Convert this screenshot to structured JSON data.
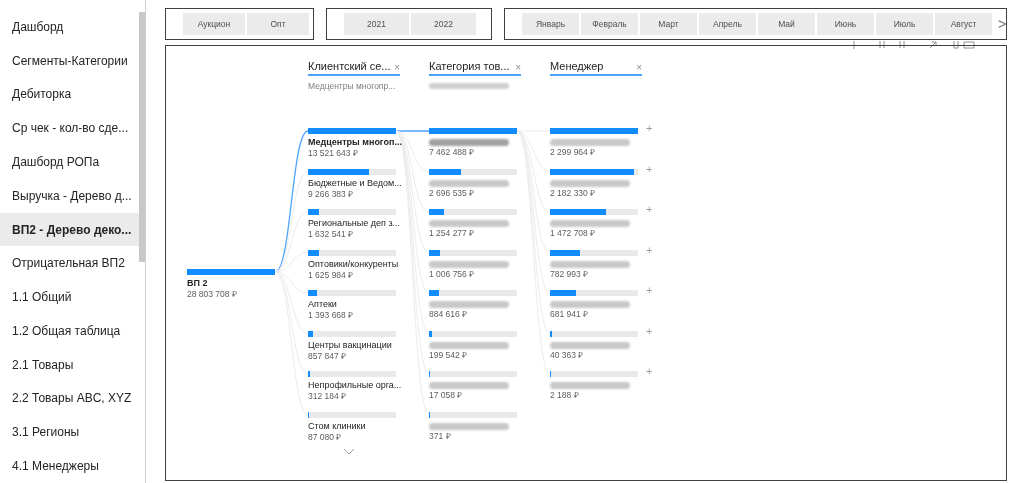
{
  "sidebar": {
    "items": [
      {
        "label": "Дашборд",
        "selected": false
      },
      {
        "label": "Сегменты-Категории",
        "selected": false
      },
      {
        "label": "Дебиторка",
        "selected": false
      },
      {
        "label": "Ср чек - кол-во сде...",
        "selected": false
      },
      {
        "label": "Дашборд РОПа",
        "selected": false
      },
      {
        "label": "Выручка - Дерево д...",
        "selected": false
      },
      {
        "label": "ВП2 - Дерево деко...",
        "selected": true
      },
      {
        "label": "Отрицательная ВП2",
        "selected": false
      },
      {
        "label": "1.1 Общий",
        "selected": false
      },
      {
        "label": "1.2 Общая таблица",
        "selected": false
      },
      {
        "label": "2.1 Товары",
        "selected": false
      },
      {
        "label": "2.2 Товары ABC, XYZ",
        "selected": false
      },
      {
        "label": "3.1 Регионы",
        "selected": false
      },
      {
        "label": "4.1 Менеджеры",
        "selected": false
      }
    ]
  },
  "slicers": [
    {
      "buttons": [
        "Аукцион",
        "Опт"
      ]
    },
    {
      "buttons": [
        "2021",
        "2022"
      ]
    },
    {
      "buttons": [
        "Январь",
        "Февраль",
        "Март",
        "Апрель",
        "Май",
        "Июнь",
        "Июль",
        "Август"
      ],
      "next": ">"
    }
  ],
  "tree": {
    "root": {
      "kind": "text",
      "label": "ВП 2",
      "value": "28 803 708 ₽",
      "level": 1
    },
    "columns": [
      {
        "header": "Клиентский се...",
        "close": "×",
        "subtitle": "Медцентры многопр...",
        "nodes": [
          {
            "kind": "text",
            "label": "Медцентры многоп...",
            "value": "13 521 643 ₽",
            "level": 1,
            "selected": true
          },
          {
            "kind": "text",
            "label": "Бюджетные и Ведом...",
            "value": "9 266 383 ₽",
            "level": 0.69,
            "selected": false
          },
          {
            "kind": "text",
            "label": "Региональные деп з...",
            "value": "1 632 541 ₽",
            "level": 0.12,
            "selected": false
          },
          {
            "kind": "text",
            "label": "Оптовики/конкуренты",
            "value": "1 625 984 ₽",
            "level": 0.12,
            "selected": false
          },
          {
            "kind": "text",
            "label": "Аптеки",
            "value": "1 393 668 ₽",
            "level": 0.1,
            "selected": false
          },
          {
            "kind": "text",
            "label": "Центры вакцинации",
            "value": "857 847 ₽",
            "level": 0.06,
            "selected": false
          },
          {
            "kind": "text",
            "label": "Непрофильные орга...",
            "value": "312 184 ₽",
            "level": 0.02,
            "selected": false
          },
          {
            "kind": "text",
            "label": "Стом клиники",
            "value": "87 080 ₽",
            "level": 0.01,
            "selected": false
          }
        ]
      },
      {
        "header": "Категория тов...",
        "close": "×",
        "subtitle_blurred": true,
        "nodes": [
          {
            "kind": "blurred",
            "value": "7 462 488 ₽",
            "level": 1,
            "selected": true
          },
          {
            "kind": "blurred",
            "value": "2 696 535 ₽",
            "level": 0.36,
            "selected": false
          },
          {
            "kind": "blurred",
            "value": "1 254 277 ₽",
            "level": 0.17,
            "selected": false
          },
          {
            "kind": "blurred",
            "value": "1 006 756 ₽",
            "level": 0.13,
            "selected": false
          },
          {
            "kind": "blurred",
            "value": "884 616 ₽",
            "level": 0.11,
            "selected": false
          },
          {
            "kind": "blurred",
            "value": "199 542 ₽",
            "level": 0.03,
            "selected": false
          },
          {
            "kind": "blurred",
            "value": "17 058 ₽",
            "level": 0.01,
            "selected": false
          },
          {
            "kind": "blurred",
            "value": "371 ₽",
            "level": 0.005,
            "selected": false
          }
        ]
      },
      {
        "header": "Менеджер",
        "close": "×",
        "expand": "+",
        "nodes": [
          {
            "kind": "blurred",
            "value": "2 299 964 ₽",
            "level": 1,
            "selected": false
          },
          {
            "kind": "blurred",
            "value": "2 182 330 ₽",
            "level": 0.95,
            "selected": false
          },
          {
            "kind": "blurred",
            "value": "1 472 708 ₽",
            "level": 0.64,
            "selected": false
          },
          {
            "kind": "blurred",
            "value": "782 993 ₽",
            "level": 0.34,
            "selected": false
          },
          {
            "kind": "blurred",
            "value": "681 941 ₽",
            "level": 0.3,
            "selected": false
          },
          {
            "kind": "blurred",
            "value": "40 363 ₽",
            "level": 0.02,
            "selected": false
          },
          {
            "kind": "blurred",
            "value": "2 188 ₽",
            "level": 0.01,
            "selected": false
          }
        ]
      }
    ]
  }
}
